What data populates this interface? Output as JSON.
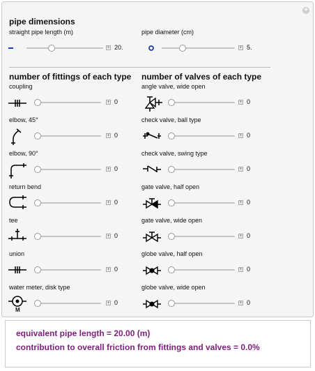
{
  "headers": {
    "pipe_dimensions": "pipe dimensions",
    "fittings": "number of fittings of each type",
    "valves": "number of valves of each type"
  },
  "pipe": {
    "length": {
      "label": "straight pipe length (m)",
      "value": "20."
    },
    "diameter": {
      "label": "pipe diameter (cm)",
      "value": "5."
    }
  },
  "fittings": [
    {
      "label": "coupling",
      "value": "0",
      "icon": "coupling-icon"
    },
    {
      "label": "elbow, 45°",
      "value": "0",
      "icon": "elbow-45-icon"
    },
    {
      "label": "elbow, 90°",
      "value": "0",
      "icon": "elbow-90-icon"
    },
    {
      "label": "return bend",
      "value": "0",
      "icon": "return-bend-icon"
    },
    {
      "label": "tee",
      "value": "0",
      "icon": "tee-icon"
    },
    {
      "label": "union",
      "value": "0",
      "icon": "union-icon"
    },
    {
      "label": "water meter, disk type",
      "value": "0",
      "icon": "water-meter-icon",
      "icon_text": "M"
    }
  ],
  "valves": [
    {
      "label": "angle valve, wide open",
      "value": "0",
      "icon": "angle-valve-icon"
    },
    {
      "label": "check valve, ball type",
      "value": "0",
      "icon": "check-valve-ball-icon"
    },
    {
      "label": "check valve, swing type",
      "value": "0",
      "icon": "check-valve-swing-icon"
    },
    {
      "label": "gate valve, half open",
      "value": "0",
      "icon": "gate-valve-half-icon"
    },
    {
      "label": "gate valve, wide open",
      "value": "0",
      "icon": "gate-valve-wide-icon"
    },
    {
      "label": "globe valve, half open",
      "value": "0",
      "icon": "globe-valve-half-icon"
    },
    {
      "label": "globe valve, wide open",
      "value": "0",
      "icon": "globe-valve-wide-icon"
    }
  ],
  "results": {
    "line1": "equivalent pipe length = 20.00 (m)",
    "line2": "contribution to overall friction from fittings and valves = 0.0%"
  },
  "colors": {
    "result_text": "#7a1f7a",
    "pipe_icon": "#1a3cb8"
  }
}
